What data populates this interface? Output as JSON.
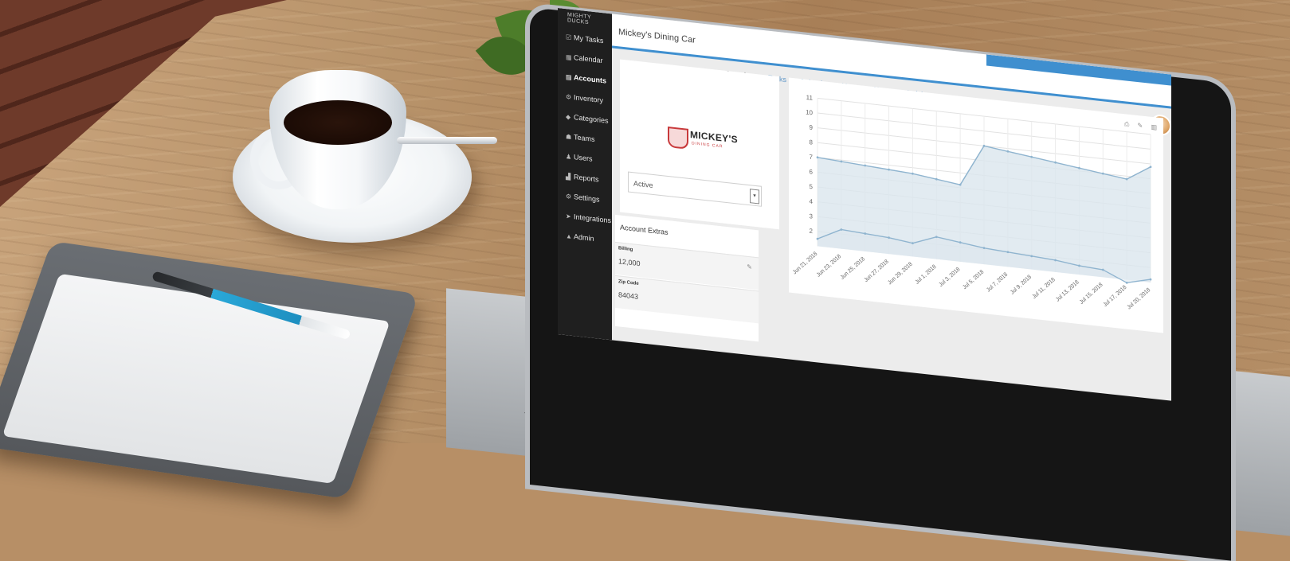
{
  "brand": "MIGHTY DUCKS",
  "nav": {
    "items": [
      {
        "label": "My Tasks",
        "icon": "checkbox-icon",
        "glyph": "☑"
      },
      {
        "label": "Calendar",
        "icon": "calendar-icon",
        "glyph": "▦"
      },
      {
        "label": "Accounts",
        "icon": "building-icon",
        "glyph": "▤",
        "active": true
      },
      {
        "label": "Inventory",
        "icon": "boxes-icon",
        "glyph": "⚙"
      },
      {
        "label": "Categories",
        "icon": "tag-icon",
        "glyph": "◆"
      },
      {
        "label": "Teams",
        "icon": "team-icon",
        "glyph": "☗"
      },
      {
        "label": "Users",
        "icon": "user-icon",
        "glyph": "♟"
      },
      {
        "label": "Reports",
        "icon": "chart-icon",
        "glyph": "▟"
      },
      {
        "label": "Settings",
        "icon": "gears-icon",
        "glyph": "⚙"
      },
      {
        "label": "Integrations",
        "icon": "plane-icon",
        "glyph": "➤"
      },
      {
        "label": "Admin",
        "icon": "lock-icon",
        "glyph": "▲"
      }
    ]
  },
  "account": {
    "title": "Mickey's Dining Car",
    "logo_text": "MICKEY'S",
    "logo_sub": "DINING CAR",
    "status": "Active"
  },
  "tabs": [
    {
      "label": "Overview",
      "active": true
    },
    {
      "label": "Tasks"
    },
    {
      "label": "Calendar"
    },
    {
      "label": "Users"
    },
    {
      "label": "Notes"
    },
    {
      "label": "Activity"
    }
  ],
  "extras": {
    "title": "Account Extras",
    "fields": [
      {
        "label": "Billing",
        "value": "12,000"
      },
      {
        "label": "Zip Code",
        "value": "84043"
      }
    ]
  },
  "colors": {
    "accent": "#3f8fcf",
    "sidebar": "#1f1f1f",
    "series_fill": "#dbe6ee",
    "series_line": "#8fb4cf",
    "logo_red": "#c8393b"
  },
  "chart_data": {
    "type": "area",
    "title": "",
    "xlabel": "",
    "ylabel": "",
    "ylim": [
      1,
      11
    ],
    "yticks": [
      2,
      3,
      4,
      5,
      6,
      7,
      8,
      9,
      10,
      11
    ],
    "x": [
      "Jun 21, 2018",
      "Jun 23, 2018",
      "Jun 25, 2018",
      "Jun 27, 2018",
      "Jun 29, 2018",
      "Jul 1, 2018",
      "Jul 3, 2018",
      "Jul 5, 2018",
      "Jul 7, 2018",
      "Jul 9, 2018",
      "Jul 11, 2018",
      "Jul 13, 2018",
      "Jul 15, 2018",
      "Jul 17, 2018",
      "Jul 20, 2018"
    ],
    "series": [
      {
        "values": [
          7,
          6.9,
          6.8,
          6.7,
          6.6,
          6.4,
          6.2,
          9.0,
          8.8,
          8.6,
          8.4,
          8.2,
          8.0,
          7.8,
          8.8
        ]
      },
      {
        "values": [
          1.5,
          2.3,
          2.2,
          2.1,
          1.9,
          2.5,
          2.3,
          2.1,
          2.0,
          1.9,
          1.8,
          1.6,
          1.5,
          0.8,
          1.2
        ]
      }
    ],
    "grid": true
  }
}
